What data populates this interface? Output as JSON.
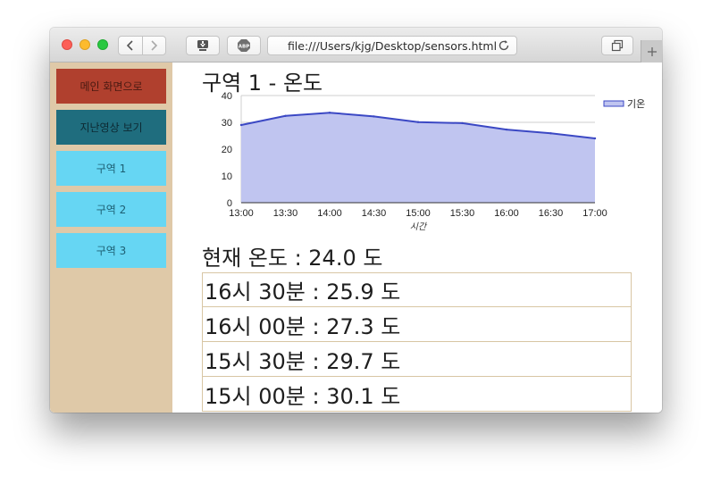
{
  "browser": {
    "address": "file:///Users/kjg/Desktop/sensors.html"
  },
  "sidebar": {
    "items": [
      {
        "label": "메인 화면으로",
        "color": "#b0402e"
      },
      {
        "label": "지난영상 보기",
        "color": "#1f6d7e"
      },
      {
        "label": "구역 1",
        "color": "#66d6f3"
      },
      {
        "label": "구역 2",
        "color": "#66d6f3"
      },
      {
        "label": "구역 3",
        "color": "#66d6f3"
      }
    ]
  },
  "main": {
    "title": "구역 1 - 온도",
    "current": "현재 온도 : 24.0 도",
    "history": [
      "16시 30분 : 25.9 도",
      "16시 00분 : 27.3 도",
      "15시 30분 : 29.7 도",
      "15시 00분 : 30.1 도"
    ]
  },
  "chart_data": {
    "type": "area",
    "categories": [
      "13:00",
      "13:30",
      "14:00",
      "14:30",
      "15:00",
      "15:30",
      "16:00",
      "16:30",
      "17:00"
    ],
    "series": [
      {
        "name": "기온",
        "values": [
          29.0,
          32.4,
          33.6,
          32.2,
          30.1,
          29.7,
          27.3,
          25.9,
          24.0
        ]
      }
    ],
    "xlabel": "시간",
    "ylabel": "",
    "ylim": [
      0,
      40
    ],
    "yticks": [
      0,
      10,
      20,
      30,
      40
    ],
    "grid": true,
    "legend": "top-right",
    "line_color": "#3b48c4",
    "fill_color": "#c0c5f0"
  }
}
